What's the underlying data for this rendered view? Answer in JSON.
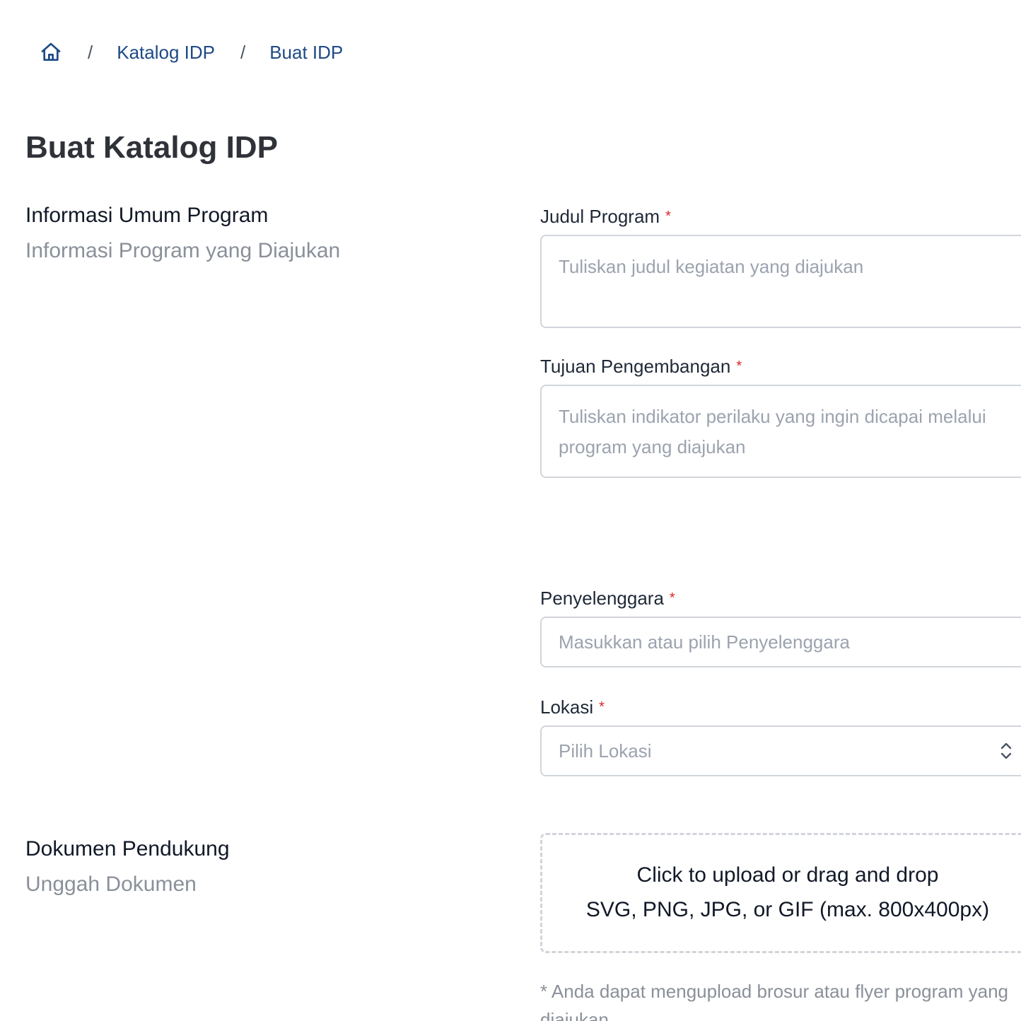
{
  "breadcrumb": {
    "home_icon": "home-icon",
    "separator": "/",
    "items": [
      "Katalog IDP",
      "Buat IDP"
    ]
  },
  "page_title": "Buat Katalog IDP",
  "sections": {
    "general": {
      "title": "Informasi Umum Program",
      "subtitle": "Informasi Program yang Diajukan"
    },
    "documents": {
      "title": "Dokumen Pendukung",
      "subtitle": "Unggah Dokumen"
    }
  },
  "fields": {
    "required_mark": "*",
    "judul": {
      "label": "Judul Program",
      "placeholder": "Tuliskan judul kegiatan yang diajukan"
    },
    "tujuan": {
      "label": "Tujuan Pengembangan",
      "placeholder_lines": [
        "Tuliskan indikator perilaku yang ingin dicapai melalui",
        "program yang diajukan"
      ]
    },
    "penyelenggara": {
      "label": "Penyelenggara",
      "placeholder": "Masukkan atau pilih Penyelenggara"
    },
    "lokasi": {
      "label": "Lokasi",
      "placeholder": "Pilih Lokasi",
      "icon": "chevron-up-down-icon"
    }
  },
  "upload": {
    "main_text": "Click to upload or drag and drop",
    "hint": "SVG, PNG, JPG, or GIF (max. 800x400px)",
    "note": "* Anda dapat mengupload brosur atau flyer program yang diajukan"
  },
  "colors": {
    "link": "#1e4a86",
    "title": "#2f3238",
    "muted": "#8a9099",
    "placeholder": "#9ca3af",
    "border": "#d1d5db",
    "required": "#dc2626"
  }
}
